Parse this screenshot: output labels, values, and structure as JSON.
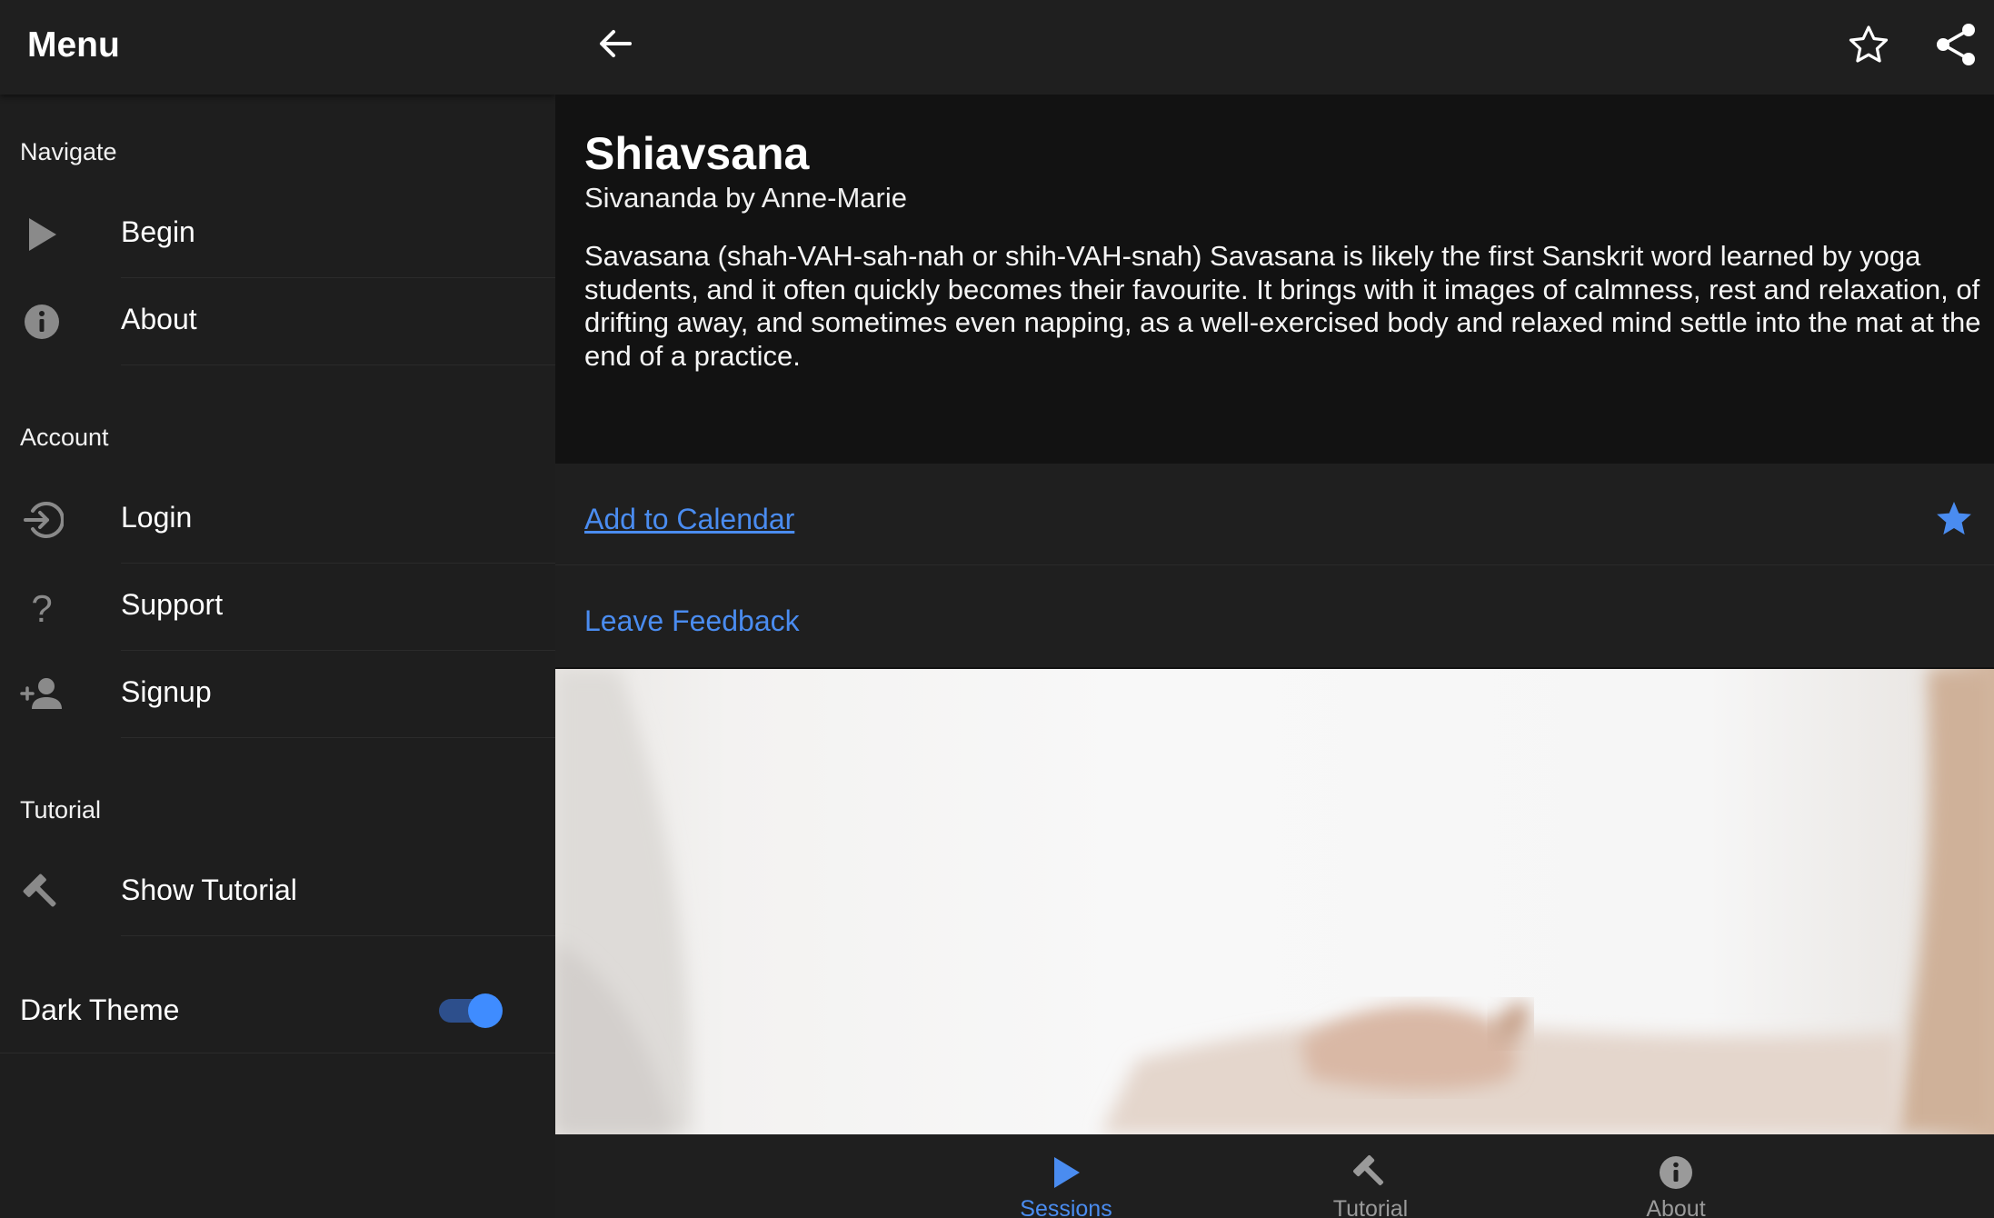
{
  "sidebar": {
    "title": "Menu",
    "sections": {
      "navigate": "Navigate",
      "account": "Account",
      "tutorial": "Tutorial"
    },
    "items": {
      "begin": "Begin",
      "about": "About",
      "login": "Login",
      "support": "Support",
      "signup": "Signup",
      "show_tutorial": "Show Tutorial"
    },
    "dark_theme": {
      "label": "Dark Theme",
      "enabled": true
    }
  },
  "session": {
    "title": "Shiavsana",
    "subtitle": "Sivananda by Anne-Marie",
    "description": "Savasana (shah-VAH-sah-nah or shih-VAH-snah) Savasana is likely the first Sanskrit word learned by yoga students, and it often quickly becomes their favourite. It brings with it images of calmness, rest and relaxation, of drifting away, and sometimes even napping, as a well-exercised body and relaxed mind settle into the mat at the end of a practice.",
    "add_to_calendar": "Add to Calendar",
    "leave_feedback": "Leave Feedback",
    "favorited": true
  },
  "tabs": {
    "sessions": "Sessions",
    "tutorial": "Tutorial",
    "about": "About",
    "active": "sessions"
  },
  "colors": {
    "accent": "#4a8cf0",
    "toggle_knob": "#3f8cff",
    "background": "#121212",
    "surface": "#1f1f1f"
  }
}
